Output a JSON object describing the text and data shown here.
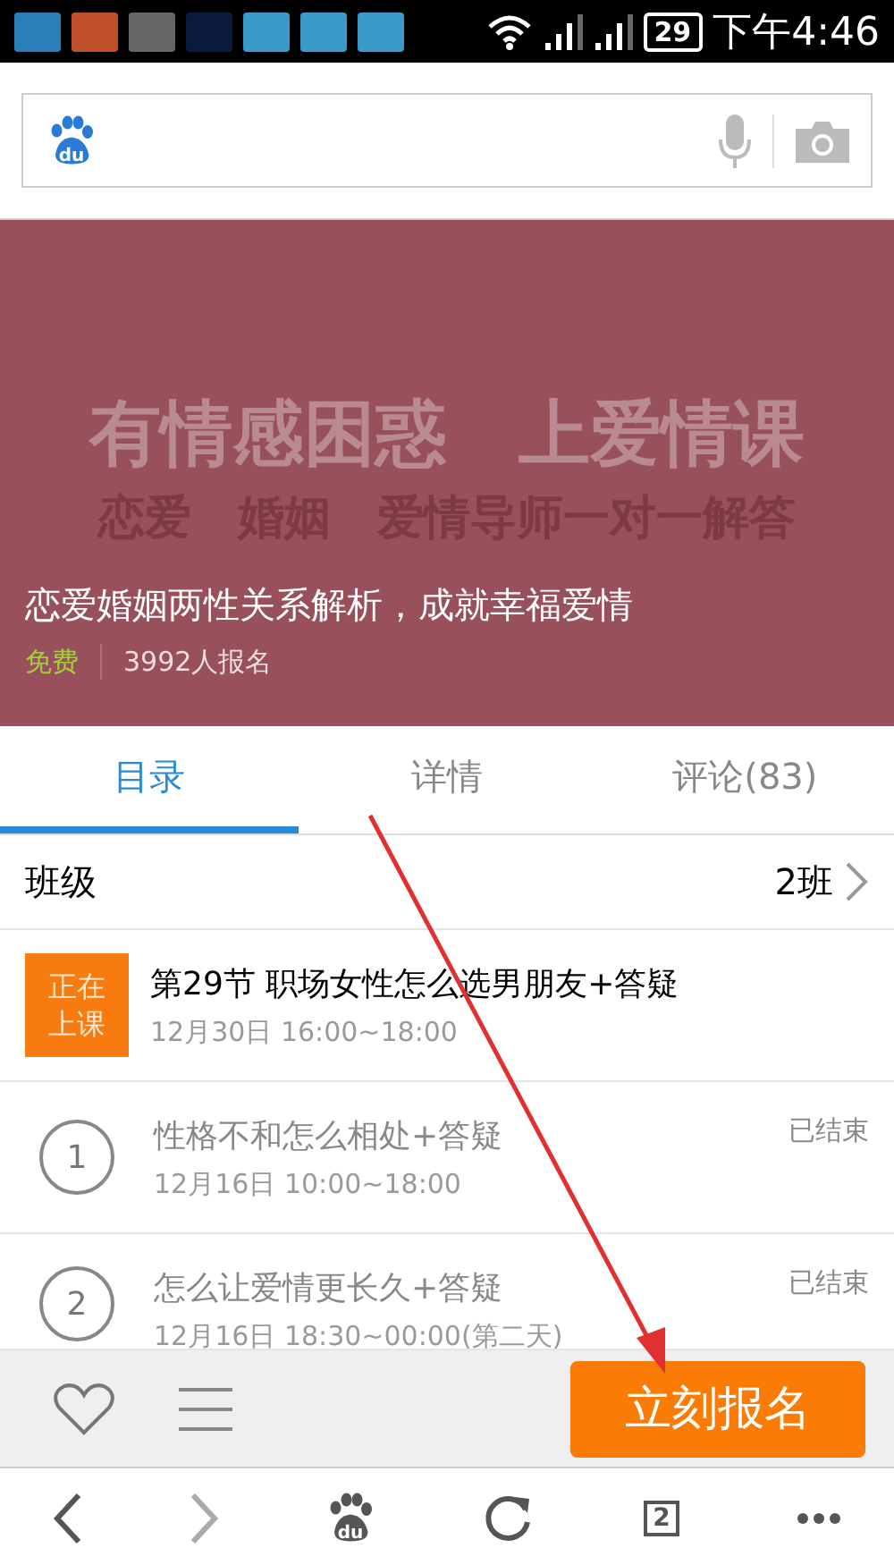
{
  "status_bar": {
    "battery": "29",
    "time": "下午4:46"
  },
  "search": {
    "logo_text": "du"
  },
  "banner": {
    "headline": "有情感困惑　上爱情课",
    "tagline": "恋爱　婚姻　爱情导师一对一解答",
    "title": "恋爱婚姻两性关系解析，成就幸福爱情",
    "price": "免费",
    "signups": "3992人报名"
  },
  "tabs": [
    {
      "label": "目录",
      "selected": true
    },
    {
      "label": "详情",
      "selected": false
    },
    {
      "label": "评论(83)",
      "selected": false
    }
  ],
  "class_row": {
    "label": "班级",
    "value": "2班"
  },
  "lessons": [
    {
      "kind": "live",
      "badge": "正在上课",
      "title": "第29节 职场女性怎么选男朋友+答疑",
      "time": "12月30日 16:00~18:00"
    },
    {
      "kind": "done",
      "number": "1",
      "title": "性格不和怎么相处+答疑",
      "time": "12月16日 10:00~18:00",
      "status": "已结束"
    },
    {
      "kind": "done",
      "number": "2",
      "title": "怎么让爱情更长久+答疑",
      "time": "12月16日 18:30~00:00(第二天)",
      "status": "已结束"
    }
  ],
  "action_bar": {
    "signup_button": "立刻报名"
  },
  "nav_bar": {
    "logo_text": "du",
    "tab_count": "2"
  }
}
